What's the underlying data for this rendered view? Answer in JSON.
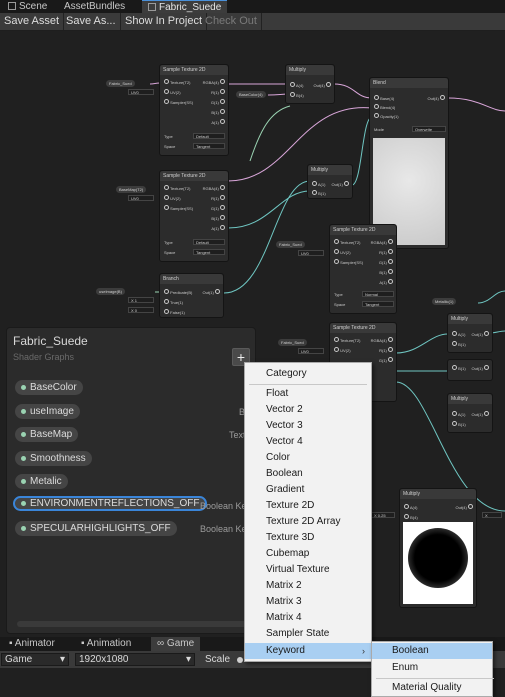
{
  "tabs": [
    {
      "label": "Scene"
    },
    {
      "label": "AssetBundles"
    },
    {
      "label": "Fabric_Suede"
    }
  ],
  "toolbar": {
    "save_asset": "Save Asset",
    "save_as": "Save As...",
    "show_in_project": "Show In Project",
    "check_out": "Check Out"
  },
  "nodes": {
    "sample1": {
      "title": "Sample Texture 2D",
      "inputs": [
        "Texture(T2)",
        "UV(2)",
        "Sampler(SS)"
      ],
      "outputs": [
        "RGBA(4)",
        "R(1)",
        "G(1)",
        "B(1)",
        "A(1)"
      ],
      "type_label": "Type",
      "type_value": "Default",
      "space_label": "Space",
      "space_value": "Tangent"
    },
    "sample2": {
      "title": "Sample Texture 2D",
      "inputs": [
        "Texture(T2)",
        "UV(2)",
        "Sampler(SS)"
      ],
      "outputs": [
        "RGBA(4)",
        "R(1)",
        "G(1)",
        "B(1)",
        "A(1)"
      ],
      "type_label": "Type",
      "type_value": "Default",
      "space_label": "Space",
      "space_value": "Tangent"
    },
    "sample3": {
      "title": "Sample Texture 2D",
      "inputs": [
        "Texture(T2)",
        "UV(2)",
        "Sampler(SS)"
      ],
      "outputs": [
        "RGBA(4)",
        "R(1)",
        "G(1)",
        "B(1)",
        "A(1)"
      ],
      "type_label": "Type",
      "type_value": "Normal",
      "space_label": "Space",
      "space_value": "Tangent"
    },
    "sample4": {
      "title": "Sample Texture 2D",
      "inputs": [
        "Texture(T2)",
        "UV(2)"
      ],
      "outputs": [
        "RGBA(4)",
        "R(1)",
        "G(1)"
      ]
    },
    "multiply1": {
      "title": "Multiply",
      "inputs": [
        "A(4)",
        "B(4)"
      ],
      "outputs": [
        "Out(4)"
      ]
    },
    "multiply2": {
      "title": "Multiply",
      "inputs": [
        "A(1)",
        "B(1)"
      ],
      "outputs": [
        "Out(1)"
      ]
    },
    "multiply3": {
      "title": "Multiply",
      "inputs": [
        "A(1)",
        "B(1)"
      ],
      "outputs": [
        "Out(1)"
      ]
    },
    "multiply4": {
      "title": "Multiply",
      "inputs": [
        "A(1)",
        "B(1)"
      ],
      "outputs": [
        "Out(1)"
      ]
    },
    "multiply5": {
      "title": "Multiply",
      "inputs": [
        "A(1)",
        "B(1)"
      ],
      "outputs": [
        "Out(1)"
      ]
    },
    "blend": {
      "title": "Blend",
      "inputs": [
        "Base(4)",
        "Blend(4)",
        "Opacity(1)"
      ],
      "outputs": [
        "Out(4)"
      ],
      "mode_label": "Mode",
      "mode_value": "Overwrite"
    },
    "branch": {
      "title": "Branch",
      "inputs": [
        "Predicate(B)",
        "True(1)",
        "False(1)"
      ],
      "outputs": [
        "Out(1)"
      ],
      "true_value": "1",
      "false_value": "0"
    },
    "pills": {
      "fabric1": "Fabric_Sued",
      "basecolor": "BaseColor(4)",
      "basemap": "BaseMap(T2)",
      "useimage": "useImage(B)",
      "fabric2": "Fabric_Sued",
      "fabric3": "Fabric_Sued",
      "metallic": "Metallic(1)",
      "uv": "UV0",
      "x_label": "X",
      "x_value": "0.25"
    }
  },
  "blackboard": {
    "title": "Fabric_Suede",
    "subtitle": "Shader Graphs",
    "add_label": "+",
    "properties": [
      {
        "name": "BaseColor",
        "type": ""
      },
      {
        "name": "useImage",
        "type": "B"
      },
      {
        "name": "BaseMap",
        "type": "Textu"
      },
      {
        "name": "Smoothness",
        "type": ""
      },
      {
        "name": "Metalic",
        "type": ""
      },
      {
        "name": "ENVIRONMENTREFLECTIONS_OFF",
        "type": "Boolean Ke"
      },
      {
        "name": "SPECULARHIGHLIGHTS_OFF",
        "type": "Boolean Ke"
      }
    ]
  },
  "context_menu": {
    "items": [
      {
        "label": "Category"
      },
      {
        "label": "Float"
      },
      {
        "label": "Vector 2"
      },
      {
        "label": "Vector 3"
      },
      {
        "label": "Vector 4"
      },
      {
        "label": "Color"
      },
      {
        "label": "Boolean"
      },
      {
        "label": "Gradient"
      },
      {
        "label": "Texture 2D"
      },
      {
        "label": "Texture 2D Array"
      },
      {
        "label": "Texture 3D"
      },
      {
        "label": "Cubemap"
      },
      {
        "label": "Virtual Texture"
      },
      {
        "label": "Matrix 2"
      },
      {
        "label": "Matrix 3"
      },
      {
        "label": "Matrix 4"
      },
      {
        "label": "Sampler State"
      },
      {
        "label": "Keyword"
      }
    ],
    "highlighted": "Keyword",
    "submenu": [
      {
        "label": "Boolean"
      },
      {
        "label": "Enum"
      },
      {
        "label": "Material Quality"
      }
    ],
    "submenu_highlighted": "Boolean"
  },
  "bottom_tabs": [
    {
      "label": "Animator"
    },
    {
      "label": "Animation"
    },
    {
      "label": "Game"
    }
  ],
  "bottom_bar": {
    "display": "Game",
    "resolution": "1920x1080",
    "scale_label": "Scale",
    "scale_value": "0."
  },
  "colors": {
    "accent": "#3a85d9",
    "menu_highlight": "#a9cff2",
    "edge_pink": "#d9a6d9",
    "edge_teal": "#6fc6c2",
    "edge_green": "#9ad3b2"
  }
}
